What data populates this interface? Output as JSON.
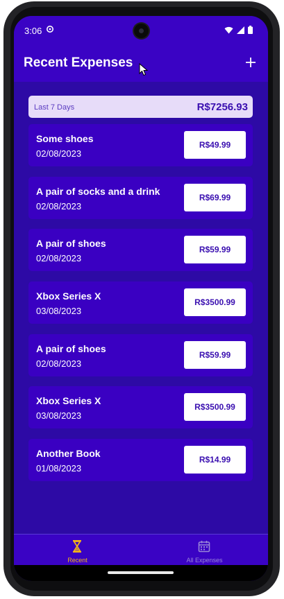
{
  "status_bar": {
    "time": "3:06"
  },
  "app_bar": {
    "title": "Recent Expenses",
    "add_icon": "plus-icon"
  },
  "summary": {
    "label": "Last 7 Days",
    "total": "R$7256.93"
  },
  "expenses": [
    {
      "title": "Some shoes",
      "date": "02/08/2023",
      "amount": "R$49.99"
    },
    {
      "title": "A pair of socks and a drink",
      "date": "02/08/2023",
      "amount": "R$69.99"
    },
    {
      "title": "A pair of shoes",
      "date": "02/08/2023",
      "amount": "R$59.99"
    },
    {
      "title": "Xbox Series X",
      "date": "03/08/2023",
      "amount": "R$3500.99"
    },
    {
      "title": "A pair of shoes",
      "date": "02/08/2023",
      "amount": "R$59.99"
    },
    {
      "title": "Xbox Series X",
      "date": "03/08/2023",
      "amount": "R$3500.99"
    },
    {
      "title": "Another Book",
      "date": "01/08/2023",
      "amount": "R$14.99"
    }
  ],
  "bottom_nav": {
    "recent_label": "Recent",
    "recent_icon": "hourglass-icon",
    "all_label": "All Expenses",
    "all_icon": "calendar-icon"
  },
  "colors": {
    "primary": "#3a03c4",
    "background": "#2d0aa5",
    "accent": "#f0b21b",
    "summary_bg": "#e7dcf9"
  }
}
